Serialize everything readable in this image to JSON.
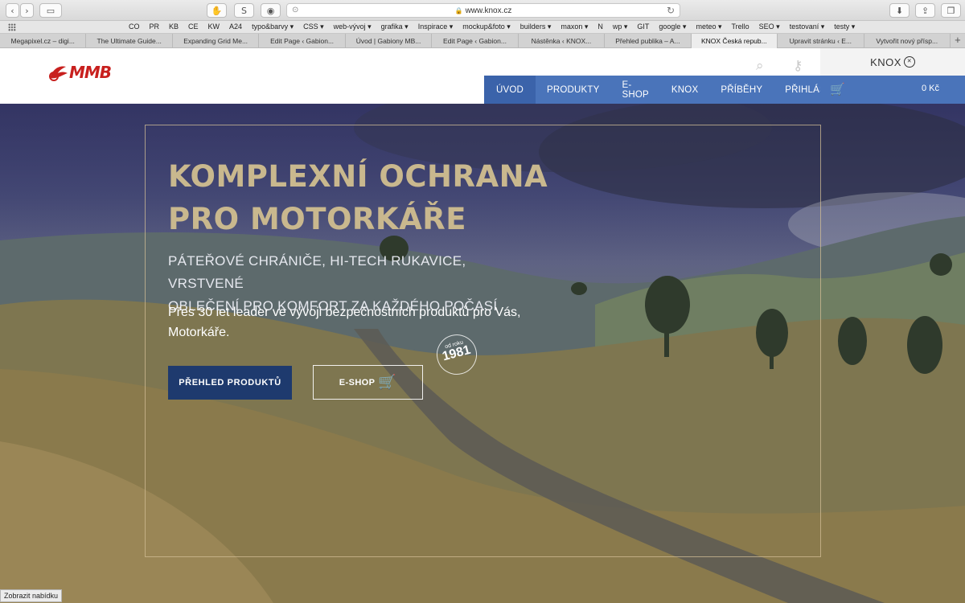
{
  "browser": {
    "url": "www.knox.cz",
    "bookmarks": [
      "CO",
      "PR",
      "KB",
      "CE",
      "KW",
      "A24",
      "typo&barvy ▾",
      "CSS ▾",
      "web-vývoj ▾",
      "grafika ▾",
      "Inspirace ▾",
      "mockup&foto ▾",
      "builders ▾",
      "maxon ▾",
      "N",
      "wp ▾",
      "GIT",
      "google ▾",
      "meteo ▾",
      "Trello",
      "SEO ▾",
      "testovaní ▾",
      "testy ▾"
    ],
    "tabs": [
      {
        "label": "Megapixel.cz – digi..."
      },
      {
        "label": "The Ultimate Guide..."
      },
      {
        "label": "Expanding Grid Me..."
      },
      {
        "label": "Edit Page ‹ Gabion..."
      },
      {
        "label": "Úvod | Gabiony MB..."
      },
      {
        "label": "Edit Page ‹ Gabion..."
      },
      {
        "label": "Nástěnka ‹ KNOX..."
      },
      {
        "label": "Přehled publika – A..."
      },
      {
        "label": "KNOX Česká repub..."
      },
      {
        "label": "Upravit stránku ‹ E..."
      },
      {
        "label": "Vytvořit nový přísp..."
      }
    ],
    "active_tab_index": 8,
    "new_tab": "+",
    "status_tooltip": "Zobrazit nabídku"
  },
  "header": {
    "logo_text": "MMB",
    "knox_label": "KNOX",
    "nav": [
      "ÚVOD",
      "PRODUKTY",
      "E-SHOP",
      "KNOX",
      "PŘÍBĚHY",
      "PŘIHLÁSIT"
    ],
    "active_nav": "ÚVOD",
    "cart_total": "0 Kč"
  },
  "hero": {
    "title_line1": "KOMPLEXNÍ OCHRANA",
    "title_line2": "PRO MOTORKÁŘE",
    "subtitle_line1": "PÁTEŘOVÉ CHRÁNIČE, HI-TECH RUKAVICE, VRSTVENÉ",
    "subtitle_line2": "OBLEČENÍ PRO KOMFORT ZA KAŽDÉHO POČASÍ",
    "description": "Přes 30 let leader ve vývoji bezpečnostních produktů pro Vás, Motorkáře.",
    "badge_small": "od roku",
    "badge_year": "1981",
    "btn_products": "PŘEHLED PRODUKTŮ",
    "btn_eshop": "E-SHOP"
  },
  "colors": {
    "nav_blue": "#4a74ba",
    "nav_active": "#3b63aa",
    "btn_dark_blue": "#1e3a6e",
    "title_gold": "#c9b88e",
    "logo_red": "#c8201e"
  }
}
